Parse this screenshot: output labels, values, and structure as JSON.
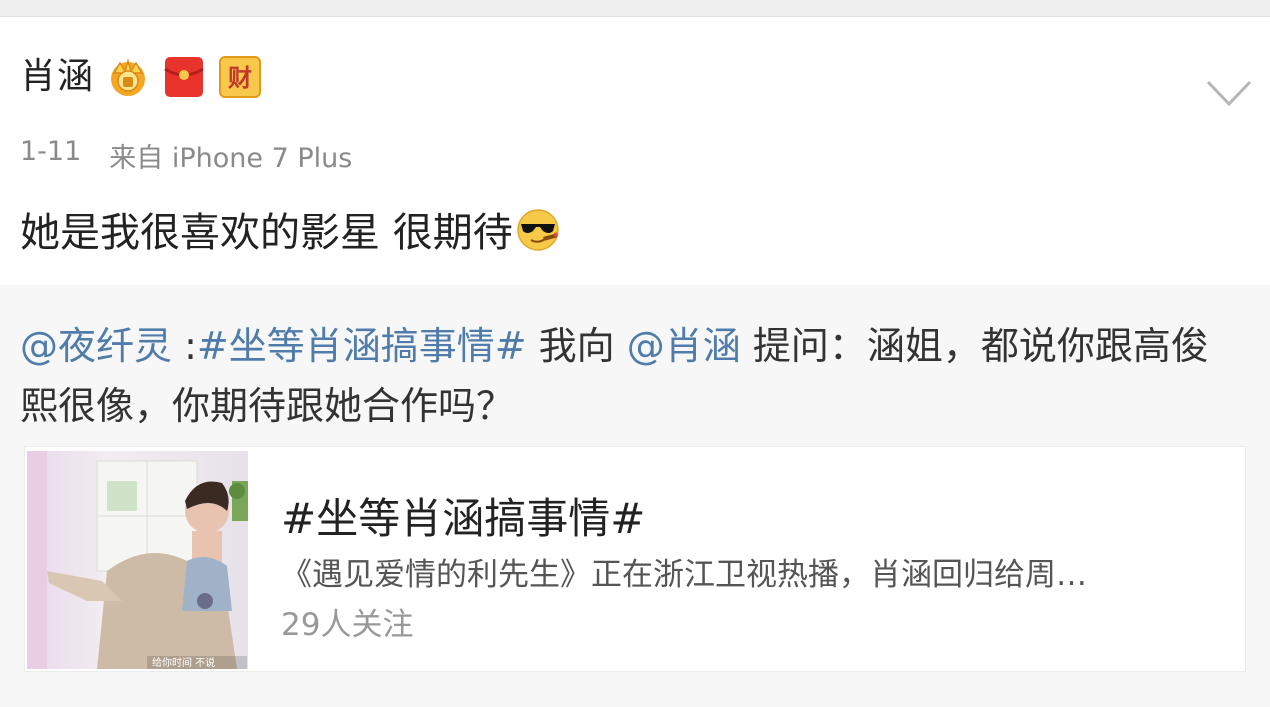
{
  "post": {
    "username": "肖涵",
    "date": "1-11",
    "source": "来自 iPhone 7 Plus",
    "text": "她是我很喜欢的影星 很期待",
    "emoji": "cool-sunglasses-cigar-emoji",
    "badges": [
      "crown-badge-icon",
      "red-packet-badge-icon",
      "cai-badge-icon"
    ],
    "cai_char": "财"
  },
  "repost": {
    "mention_author": "@夜纤灵",
    "separator": " :",
    "topic": "#坐等肖涵搞事情#",
    "mid_text": " 我向 ",
    "mention_target": "@肖涵",
    "question": " 提问：涵姐，都说你跟高俊熙很像，你期待跟她合作吗？"
  },
  "topic_card": {
    "title": "#坐等肖涵搞事情#",
    "description": "《遇见爱情的利先生》正在浙江卫视热播，肖涵回归给周…",
    "followers": "29人关注",
    "thumb_caption": "给你时间 不说"
  },
  "colors": {
    "link": "#4f7caa",
    "background": "#f7f7f7",
    "post_bg": "#ffffff"
  }
}
